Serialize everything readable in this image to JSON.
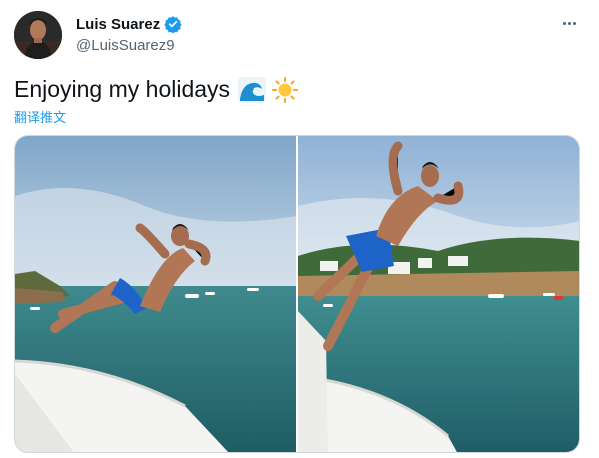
{
  "author": {
    "display_name": "Luis Suarez",
    "handle": "@LuisSuarez9",
    "verified": true,
    "avatar_icon": "avatar-photo"
  },
  "tweet": {
    "text": "Enjoying my holidays",
    "emojis": [
      "water-wave-emoji",
      "sun-emoji"
    ],
    "translate_label": "翻译推文"
  },
  "media": {
    "photos": [
      {
        "description_icon": "photo-man-jumping-from-boat-1"
      },
      {
        "description_icon": "photo-man-jumping-from-boat-2"
      }
    ]
  },
  "colors": {
    "link": "#1d9bf0",
    "verified": "#1d9bf0",
    "secondary_text": "#536471",
    "border": "#cfd9de"
  }
}
